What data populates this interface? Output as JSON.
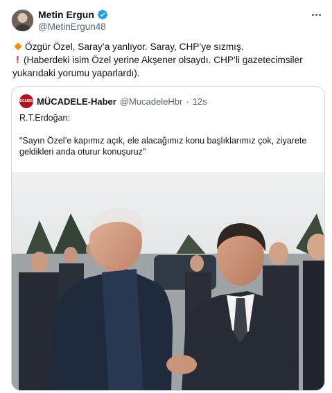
{
  "author": {
    "display_name": "Metin Ergun",
    "handle": "@MetinErgun48",
    "verified": true
  },
  "tweet": {
    "line1": "Özgür Özel, Saray’a yanlıyor. Saray, CHP’ye sızmış.",
    "line2": "(Haberdeki isim Özel yerine Akşener olsaydı. CHP’li gazetecimsiler",
    "line3": "yukarıdaki yorumu yaparlardı).",
    "emoji1": "orange-diamond-icon",
    "emoji2": "red-exclamation-icon"
  },
  "quote": {
    "display_name": "MÜCADELE-Haber",
    "handle": "@MucadeleHbr",
    "separator": "·",
    "time": "12s",
    "line1": "R.T.Erdoğan:",
    "line2": "\"Sayın Özel’e kapımız açık, ele alacağımız konu başlıklarımız çok, ziyarete",
    "line3": "geldikleri anda oturur konuşuruz\"",
    "avatar_icon": "mucadele-logo-icon"
  },
  "colors": {
    "verified": "#1d9bf0",
    "muted_text": "#536471",
    "border": "#cfd9de",
    "quote_avatar": "#b3121b"
  }
}
